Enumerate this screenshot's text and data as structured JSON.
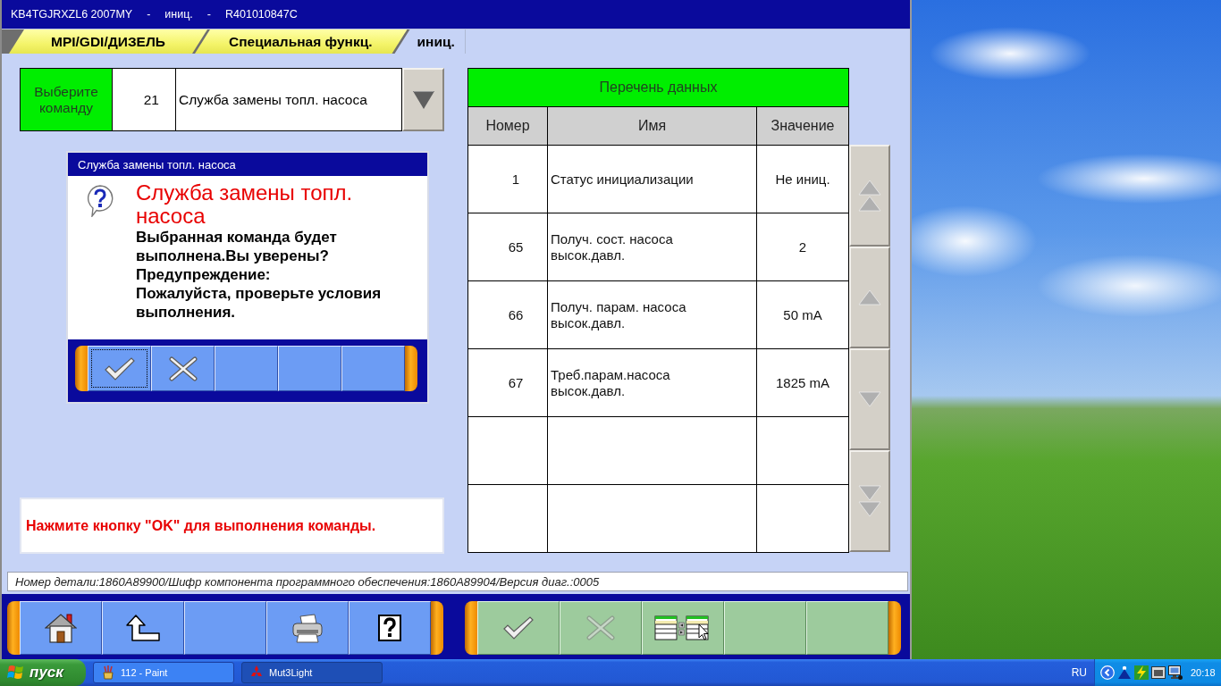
{
  "window": {
    "title_parts": [
      "KB4TGJRXZL6 2007MY",
      "-",
      "иниц.",
      "-",
      "R401010847C"
    ]
  },
  "breadcrumbs": [
    {
      "label": "MPI/GDI/ДИЗЕЛЬ",
      "selected": false
    },
    {
      "label": "Специальная функц.",
      "selected": false
    },
    {
      "label": "иниц.",
      "selected": true
    }
  ],
  "command": {
    "label": "Выберите команду",
    "number": "21",
    "name": "Служба замены топл. насоса"
  },
  "dialog": {
    "title": "Служба замены топл. насоса",
    "heading": "Служба замены топл. насоса",
    "lines": [
      "Выбранная команда будет выполнена.Вы уверены?",
      "Предупреждение:",
      "Пожалуйста, проверьте условия выполнения."
    ],
    "buttons": [
      {
        "kind": "ok",
        "focused": true
      },
      {
        "kind": "cancel",
        "focused": false
      },
      {
        "kind": "blank",
        "focused": false
      },
      {
        "kind": "blank",
        "focused": false
      },
      {
        "kind": "blank",
        "focused": false
      }
    ]
  },
  "message": "Нажмите кнопку \"OK\" для выполнения команды.",
  "data_list": {
    "title": "Перечень данных",
    "columns": [
      "Номер",
      "Имя",
      "Значение"
    ],
    "rows": [
      {
        "number": "1",
        "name": "Статус инициализации",
        "value": "Не иниц."
      },
      {
        "number": "65",
        "name": "Получ. сост. насоса высок.давл.",
        "value": "2"
      },
      {
        "number": "66",
        "name": "Получ. парам. насоса высок.давл.",
        "value": "50 mA"
      },
      {
        "number": "67",
        "name": "Треб.парам.насоса высок.давл.",
        "value": "1825 mA"
      }
    ]
  },
  "scroll_buttons": [
    {
      "kind": "top"
    },
    {
      "kind": "up"
    },
    {
      "kind": "down"
    },
    {
      "kind": "bottom"
    }
  ],
  "status_bar": "Номер детали:1860A89900/Шифр компонента программного обеспечения:1860A89904/Версия диаг.:0005",
  "toolbar_left": [
    {
      "kind": "home"
    },
    {
      "kind": "up"
    },
    {
      "kind": "blank"
    },
    {
      "kind": "print"
    },
    {
      "kind": "help"
    }
  ],
  "toolbar_right": [
    {
      "kind": "ok",
      "disabled": false
    },
    {
      "kind": "cancel",
      "disabled": true
    },
    {
      "kind": "tables",
      "disabled": false
    },
    {
      "kind": "blank"
    },
    {
      "kind": "blank"
    }
  ],
  "taskbar": {
    "start": "пуск",
    "tasks": [
      {
        "label": "112 - Paint",
        "kind": "paint",
        "selected": false
      },
      {
        "label": "Mut3Light",
        "kind": "diamonds",
        "selected": true
      }
    ],
    "language": "RU",
    "clock": "20:18"
  }
}
